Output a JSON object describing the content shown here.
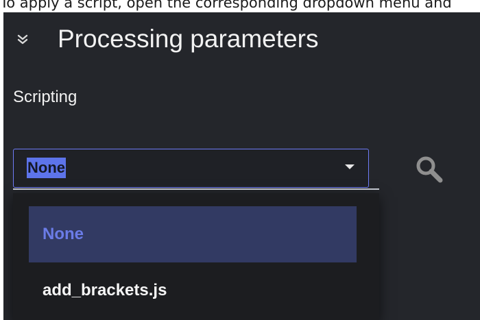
{
  "caption": {
    "text": "To apply a script, open the corresponding dropdown menu and"
  },
  "section": {
    "title": "Processing parameters",
    "collapse_icon": "double-chevron-down-icon"
  },
  "scripting": {
    "label": "Scripting",
    "selected_value": "None",
    "dropdown_icon": "caret-down-icon",
    "search_icon": "search-icon",
    "options": [
      {
        "label": "None",
        "selected": true
      },
      {
        "label": "add_brackets.js",
        "selected": false
      }
    ]
  },
  "colors": {
    "panel_background": "#24262b",
    "accent": "#5d74ea",
    "selected_option_background": "#323a63"
  }
}
